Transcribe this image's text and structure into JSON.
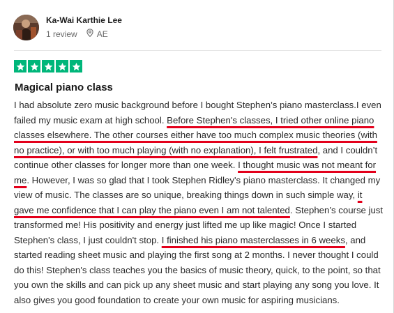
{
  "author": {
    "name": "Ka-Wai Karthie Lee",
    "review_count": "1 review",
    "location": "AE"
  },
  "icons": {
    "location": "location-pin-icon",
    "star": "star-icon"
  },
  "rating": {
    "value": 5,
    "max": 5,
    "color": "#00b67a"
  },
  "review": {
    "title": "Magical piano class",
    "segments": [
      {
        "text": "I had absolute zero music background before I bought Stephen’s piano masterclass.I even failed my music exam at high school. ",
        "highlight": false
      },
      {
        "text": "Before Stephen's classes, I tried other online piano classes elsewhere. The other courses either have too much complex music theories (with no practice), or with too much playing (with no explanation), I felt frustrated",
        "highlight": true
      },
      {
        "text": ", and I couldn’t continue other classes for longer more than one week. ",
        "highlight": false
      },
      {
        "text": "I thought music was not meant for me",
        "highlight": true
      },
      {
        "text": ". However, I was so glad that I took Stephen Ridley's piano masterclass. It changed my view of music. The classes are so unique, breaking things down in such simple way, ",
        "highlight": false
      },
      {
        "text": "it gave me confidence that I can play the piano even I am not talented",
        "highlight": true
      },
      {
        "text": ". Stephen’s course just transformed me! His positivity and energy just lifted me up like magic! Once I started Stephen's class, I just couldn't stop. ",
        "highlight": false
      },
      {
        "text": "I finished his piano masterclasses in 6 weeks",
        "highlight": true
      },
      {
        "text": ", and started reading sheet music and playing the first song at 2 months. I never thought I could do this! Stephen's class teaches you the basics of music theory, quick, to the point, so that you own the skills and can pick up any sheet music and start playing any song you love. It also gives you good foundation to create your own music for aspiring musicians.",
        "highlight": false
      }
    ]
  },
  "annotation_color": "#e3001b"
}
